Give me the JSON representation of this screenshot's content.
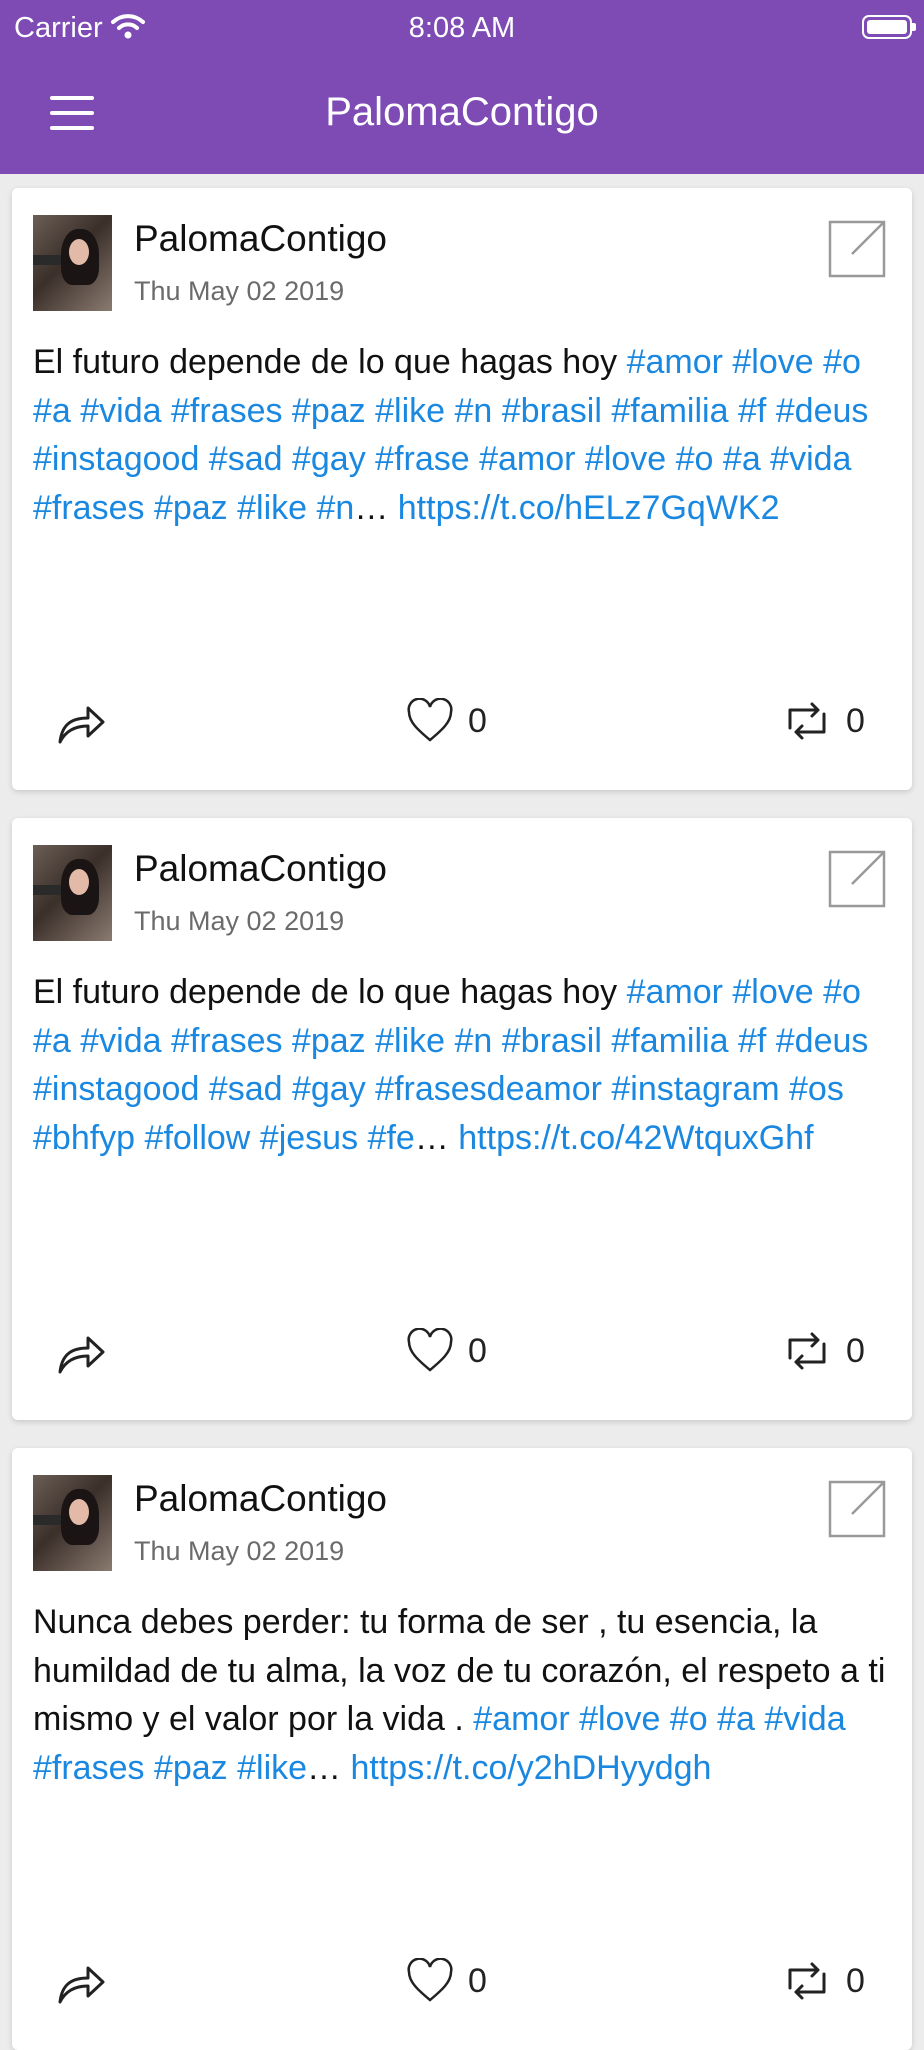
{
  "status_bar": {
    "carrier": "Carrier",
    "time": "8:08 AM"
  },
  "nav": {
    "title": "PalomaContigo"
  },
  "posts": [
    {
      "user": "PalomaContigo",
      "date": "Thu May 02 2019",
      "text_plain": "El futuro depende de lo que hagas hoy ",
      "hashtags": "#amor #love #o #a #vida #frases #paz #like #n #brasil #familia #f #deus #instagood #sad #gay #frase #amor #love #o #a #vida #frases #paz #like #n",
      "ellipsis": "… ",
      "link": "https://t.co/hELz7GqWK2",
      "likes": "0",
      "retweets": "0"
    },
    {
      "user": "PalomaContigo",
      "date": "Thu May 02 2019",
      "text_plain": "El futuro depende de lo que hagas hoy ",
      "hashtags": "#amor #love #o #a #vida #frases #paz #like #n #brasil #familia #f #deus #instagood #sad #gay #frasesdeamor #instagram #os #bhfyp #follow #jesus #fe",
      "ellipsis": "… ",
      "link": "https://t.co/42WtquxGhf",
      "likes": "0",
      "retweets": "0"
    },
    {
      "user": "PalomaContigo",
      "date": "Thu May 02 2019",
      "text_plain": "Nunca debes perder: tu forma de ser , tu esencia, la humildad de tu alma, la voz de tu corazón, el respeto a ti mismo y el valor por la vida . ",
      "hashtags": "#amor #love #o #a #vida #frases #paz #like",
      "ellipsis": "… ",
      "link": "https://t.co/y2hDHyydgh",
      "likes": "0",
      "retweets": "0"
    }
  ],
  "colors": {
    "brand": "#7e4bb5",
    "link": "#1a88e0",
    "background": "#ececec"
  },
  "icons": {
    "menu": "hamburger-icon",
    "external": "external-link-icon",
    "share": "share-icon",
    "like": "heart-icon",
    "retweet": "retweet-icon",
    "wifi": "wifi-icon",
    "battery": "battery-icon"
  }
}
